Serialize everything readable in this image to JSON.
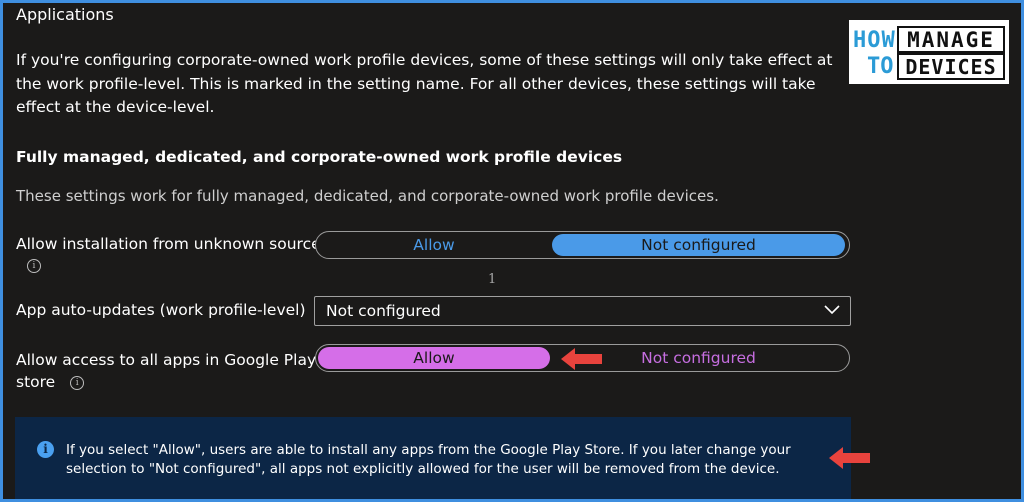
{
  "section": {
    "title": "Applications"
  },
  "intro": "If you're configuring corporate-owned work profile devices, some of these settings will only take effect at the work profile-level. This is marked in the setting name. For all other devices, these settings will take effect at the device-level.",
  "group": {
    "title": "Fully managed, dedicated, and corporate-owned work profile devices",
    "description": "These settings work for fully managed, dedicated, and corporate-owned work profile devices."
  },
  "settings": {
    "unknown_sources": {
      "label": "Allow installation from unknown sources",
      "options": [
        "Allow",
        "Not configured"
      ],
      "selected": "Not configured"
    },
    "stray_text": "1",
    "auto_updates": {
      "label": "App auto-updates (work profile-level)",
      "value": "Not configured"
    },
    "play_store": {
      "label_line1": "Allow access to all apps in Google Play",
      "label_line2": "store",
      "options": [
        "Allow",
        "Not configured"
      ],
      "selected": "Allow"
    }
  },
  "info_message": "If you select \"Allow\", users are able to install any apps from the Google Play Store. If you later change your selection to \"Not configured\", all apps not explicitly allowed for the user will be removed from the device.",
  "logo": {
    "how": "HOW",
    "to": "TO",
    "manage": "MANAGE",
    "devices": "DEVICES"
  },
  "icons": {
    "info": "info-icon",
    "chevron": "chevron-down-icon",
    "arrow": "red-arrow-left-icon"
  },
  "colors": {
    "background": "#1b1a19",
    "toggle_selected_blue": "#4a9ae8",
    "toggle_selected_purple": "#d56ee8",
    "accent_text_blue": "#4a9ae8",
    "accent_text_purple": "#c66ee0",
    "info_box": "#0c2646",
    "arrow_red": "#e8433d",
    "frame_border": "#3f8fe0"
  }
}
